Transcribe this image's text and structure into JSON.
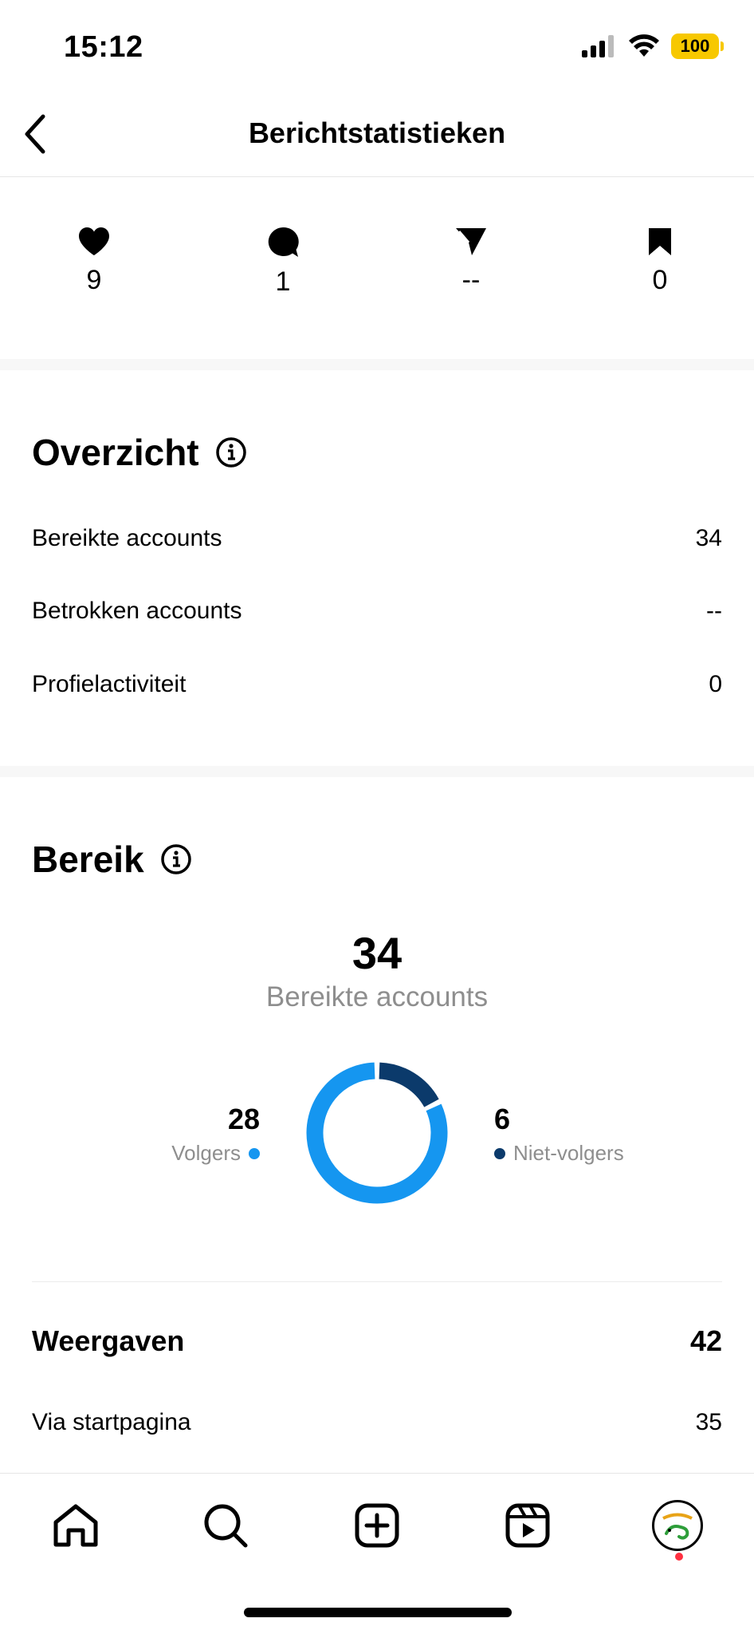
{
  "status_bar": {
    "time": "15:12",
    "battery": "100"
  },
  "header": {
    "title": "Berichtstatistieken"
  },
  "engagement": [
    {
      "icon": "heart-icon",
      "value": "9"
    },
    {
      "icon": "comment-icon",
      "value": "1"
    },
    {
      "icon": "share-icon",
      "value": "--"
    },
    {
      "icon": "bookmark-icon",
      "value": "0"
    }
  ],
  "overview": {
    "title": "Overzicht",
    "rows": [
      {
        "label": "Bereikte accounts",
        "value": "34"
      },
      {
        "label": "Betrokken accounts",
        "value": "--"
      },
      {
        "label": "Profielactiviteit",
        "value": "0"
      }
    ]
  },
  "reach": {
    "title": "Bereik",
    "total": "34",
    "total_label": "Bereikte accounts",
    "followers": {
      "value": "28",
      "label": "Volgers",
      "color": "#1596f0"
    },
    "non_followers": {
      "value": "6",
      "label": "Niet-volgers",
      "color": "#0b3a6b"
    }
  },
  "views": {
    "label": "Weergaven",
    "value": "42",
    "via_label": "Via startpagina",
    "via_value": "35"
  },
  "tab_bar": [
    "home-icon",
    "search-icon",
    "create-icon",
    "reels-icon",
    "profile-avatar"
  ]
}
